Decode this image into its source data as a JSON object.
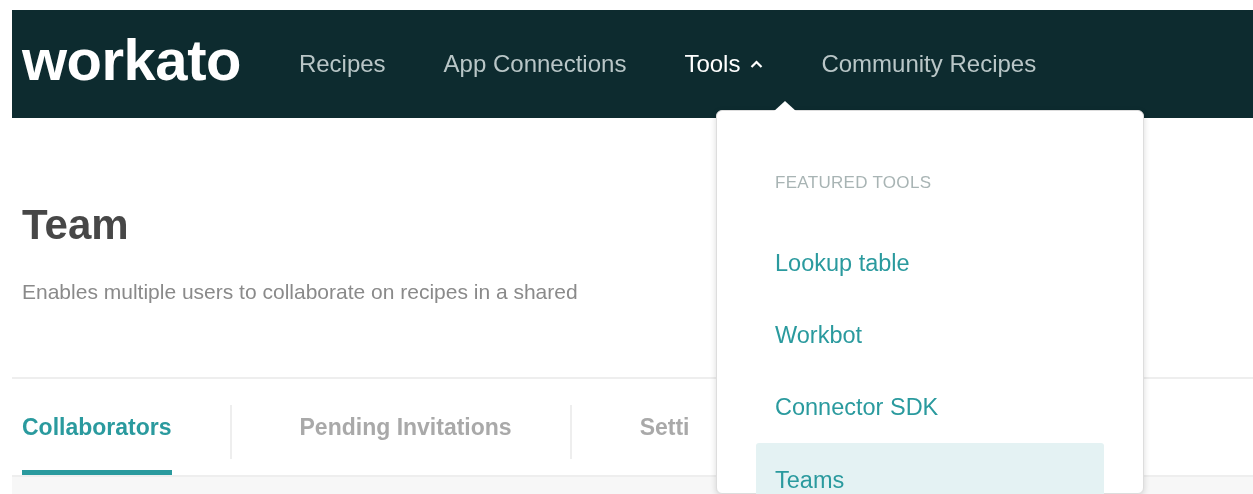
{
  "nav": {
    "logo": "workato",
    "items": [
      {
        "label": "Recipes",
        "expanded": false
      },
      {
        "label": "App Connections",
        "expanded": false
      },
      {
        "label": "Tools",
        "expanded": true
      },
      {
        "label": "Community Recipes",
        "expanded": false
      }
    ]
  },
  "page": {
    "title": "Team",
    "description": "Enables multiple users to collaborate on recipes in a shared",
    "tabs": [
      {
        "label": "Collaborators",
        "selected": true
      },
      {
        "label": "Pending Invitations",
        "selected": false
      },
      {
        "label": "Setti",
        "selected": false
      }
    ]
  },
  "tools_menu": {
    "heading": "FEATURED TOOLS",
    "items": [
      {
        "label": "Lookup table",
        "selected": false
      },
      {
        "label": "Workbot",
        "selected": false
      },
      {
        "label": "Connector SDK",
        "selected": false
      },
      {
        "label": "Teams",
        "selected": true
      }
    ]
  }
}
